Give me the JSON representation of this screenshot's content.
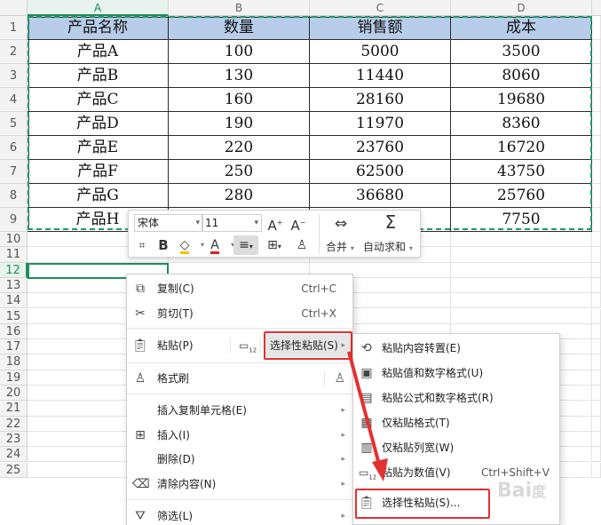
{
  "columns": [
    "A",
    "B",
    "C",
    "D"
  ],
  "rows": [
    "1",
    "2",
    "3",
    "4",
    "5",
    "6",
    "7",
    "8",
    "9",
    "10",
    "11",
    "12",
    "13",
    "14",
    "15",
    "16",
    "17",
    "18",
    "19",
    "20",
    "21",
    "22",
    "23",
    "24",
    "25"
  ],
  "table": {
    "header": [
      "产品名称",
      "数量",
      "销售额",
      "成本"
    ],
    "data": [
      [
        "产品A",
        "100",
        "5000",
        "3500"
      ],
      [
        "产品B",
        "130",
        "11440",
        "8060"
      ],
      [
        "产品C",
        "160",
        "28160",
        "19680"
      ],
      [
        "产品D",
        "190",
        "11970",
        "8360"
      ],
      [
        "产品E",
        "220",
        "23760",
        "16720"
      ],
      [
        "产品F",
        "250",
        "62500",
        "43750"
      ],
      [
        "产品G",
        "280",
        "36680",
        "25760"
      ],
      [
        "产品H",
        "",
        "",
        "7750"
      ]
    ],
    "header_color": "#b7cde9"
  },
  "mini_toolbar": {
    "font_name": "宋体",
    "font_size": "11",
    "bold_label": "B",
    "font_color_label": "A",
    "merge_label": "合并",
    "autosum_label": "自动求和"
  },
  "context_menu": {
    "copy": {
      "label": "复制(C)",
      "shortcut": "Ctrl+C",
      "icon": "copy-icon"
    },
    "cut": {
      "label": "剪切(T)",
      "shortcut": "Ctrl+X",
      "icon": "scissors-icon"
    },
    "paste": {
      "label": "粘贴(P)",
      "icon": "paste-icon"
    },
    "paste_special": {
      "label": "选择性粘贴(S)"
    },
    "format_painter": {
      "label": "格式刷",
      "icon": "format-painter-icon"
    },
    "insert_copied": {
      "label": "插入复制单元格(E)"
    },
    "insert": {
      "label": "插入(I)"
    },
    "delete": {
      "label": "删除(D)"
    },
    "clear": {
      "label": "清除内容(N)"
    },
    "filter": {
      "label": "筛选(L)"
    }
  },
  "submenu": {
    "items": [
      {
        "label": "粘贴内容转置(E)",
        "shortcut": ""
      },
      {
        "label": "粘贴值和数字格式(U)",
        "shortcut": ""
      },
      {
        "label": "粘贴公式和数字格式(R)",
        "shortcut": ""
      },
      {
        "label": "仅粘贴格式(T)",
        "shortcut": ""
      },
      {
        "label": "仅粘贴列宽(W)",
        "shortcut": ""
      },
      {
        "label": "粘贴为数值(V)",
        "shortcut": "Ctrl+Shift+V"
      },
      {
        "label": "选择性粘贴(S)...",
        "shortcut": ""
      }
    ]
  },
  "accent_color": "#1e8e5a",
  "highlight_color": "#e33131"
}
